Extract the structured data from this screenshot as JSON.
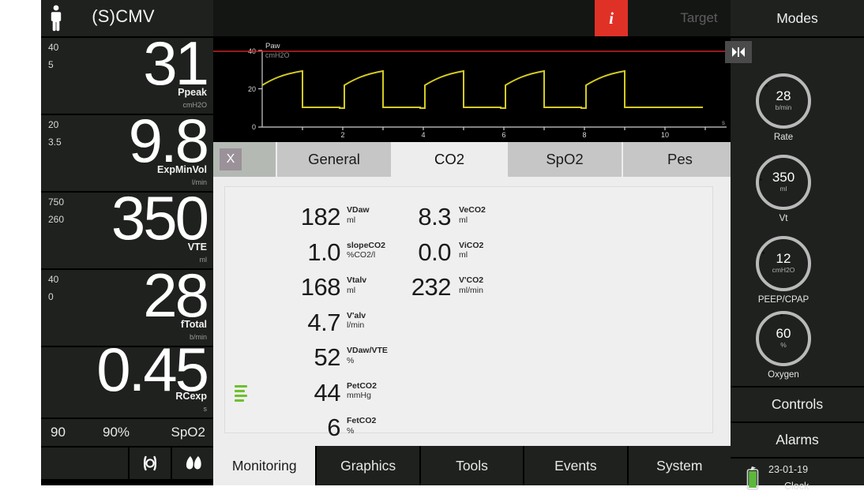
{
  "left_panel": {
    "patient_icon": "adult-patient-icon",
    "mode": "(S)CMV",
    "measurements": [
      {
        "high": "40",
        "low": "5",
        "value": "31",
        "label": "Ppeak",
        "unit": "cmH2O"
      },
      {
        "high": "20",
        "low": "3.5",
        "value": "9.8",
        "label": "ExpMinVol",
        "unit": "l/min"
      },
      {
        "high": "750",
        "low": "260",
        "value": "350",
        "label": "VTE",
        "unit": "ml"
      },
      {
        "high": "40",
        "low": "0",
        "value": "28",
        "label": "fTotal",
        "unit": "b/min"
      },
      {
        "high": "",
        "low": "",
        "value": "0.45",
        "label": "RCexp",
        "unit": "s"
      }
    ],
    "spo2_row": {
      "low_limit": "90",
      "value": "90%",
      "label": "SpO2"
    },
    "tool_icons": [
      "lung-mechanics-icon",
      "nebulizer-icon"
    ]
  },
  "top_bar": {
    "info_glyph": "i",
    "target_label": "Target"
  },
  "waveform": {
    "title": "Paw",
    "unit": "cmH2O",
    "hold_icon": "expiratory-hold-icon",
    "y_ticks": [
      "40",
      "20",
      "0"
    ],
    "x_ticks": [
      "2",
      "4",
      "6",
      "8",
      "10"
    ],
    "x_unit": "s",
    "alarm_line_value": 40,
    "trace_color": "#d4cb20",
    "alarm_color": "#cc2222"
  },
  "panel": {
    "close_label": "X",
    "tabs": [
      {
        "label": "General",
        "active": false
      },
      {
        "label": "CO2",
        "active": true
      },
      {
        "label": "SpO2",
        "active": false
      },
      {
        "label": "Pes",
        "active": false
      }
    ],
    "values_col_a": [
      {
        "value": "182",
        "name": "VDaw",
        "unit": "ml"
      },
      {
        "value": "1.0",
        "name": "slopeCO2",
        "unit": "%CO2/l"
      },
      {
        "value": "168",
        "name": "Vtalv",
        "unit": "ml"
      },
      {
        "value": "4.7",
        "name": "V'alv",
        "unit": "l/min"
      },
      {
        "value": "52",
        "name": "VDaw/VTE",
        "unit": "%"
      },
      {
        "value": "44",
        "name": "PetCO2",
        "unit": "mmHg",
        "indicator": "signal-bars-green"
      },
      {
        "value": "6",
        "name": "FetCO2",
        "unit": "%"
      }
    ],
    "values_col_b": [
      {
        "value": "8.3",
        "name": "VeCO2",
        "unit": "ml"
      },
      {
        "value": "0.0",
        "name": "ViCO2",
        "unit": "ml"
      },
      {
        "value": "232",
        "name": "V'CO2",
        "unit": "ml/min"
      }
    ]
  },
  "bottom_nav": [
    {
      "label": "Monitoring",
      "active": true
    },
    {
      "label": "Graphics",
      "active": false
    },
    {
      "label": "Tools",
      "active": false
    },
    {
      "label": "Events",
      "active": false
    },
    {
      "label": "System",
      "active": false
    }
  ],
  "right_panel": {
    "modes_label": "Modes",
    "knobs": [
      {
        "value": "28",
        "unit": "b/min",
        "label": "Rate"
      },
      {
        "value": "350",
        "unit": "ml",
        "label": "Vt"
      },
      {
        "value": "12",
        "unit": "cmH2O",
        "label": "PEEP/CPAP"
      },
      {
        "value": "60",
        "unit": "%",
        "label": "Oxygen"
      }
    ],
    "controls_label": "Controls",
    "alarms_label": "Alarms",
    "battery_icon": "battery-charging-icon",
    "clock_date": "23-01-19",
    "clock_label": "Clock"
  }
}
